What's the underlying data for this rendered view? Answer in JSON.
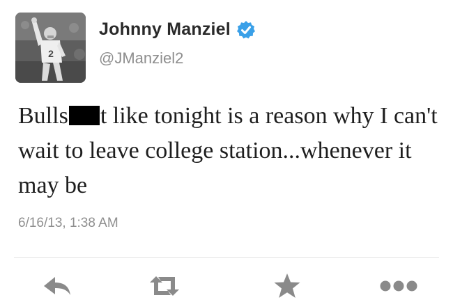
{
  "tweet": {
    "author": {
      "display_name": "Johnny Manziel",
      "handle": "@JManziel2",
      "verified": true,
      "avatar_icon": "football-player-avatar"
    },
    "text_parts": {
      "before_redaction": "Bulls",
      "after_redaction": "t like tonight is a reason why I can't wait to leave college station...whenever it may be"
    },
    "timestamp": "6/16/13, 1:38 AM"
  },
  "actions": [
    {
      "name": "reply",
      "icon": "reply-arrow-icon"
    },
    {
      "name": "retweet",
      "icon": "retweet-icon"
    },
    {
      "name": "favorite",
      "icon": "star-icon"
    },
    {
      "name": "more",
      "icon": "more-dots-icon"
    }
  ],
  "colors": {
    "verified_badge": "#3aa0e8",
    "icon_gray": "#8a8a8a",
    "handle_gray": "#8e8e8e",
    "text": "#1e1e1e"
  }
}
